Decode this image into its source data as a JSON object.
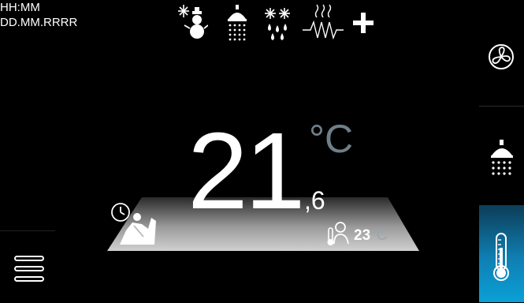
{
  "status": {
    "time": "HH:MM",
    "date": "DD.MM.RRRR"
  },
  "mode_icons": [
    "snowman-icon",
    "shower-icon",
    "snow-rain-icon",
    "heating-wave-icon",
    "plus-icon"
  ],
  "main": {
    "temp_integer": "21",
    "temp_decimal": ",6",
    "temp_unit": "°C",
    "room_temp_value": "23",
    "room_temp_unit": "°C"
  },
  "sidebar": {
    "items": [
      {
        "name": "ventilation",
        "icon": "fan-icon",
        "active": false
      },
      {
        "name": "hot-water",
        "icon": "shower-icon",
        "active": false
      },
      {
        "name": "heating",
        "icon": "thermometer-icon",
        "active": true
      }
    ]
  },
  "colors": {
    "background": "#000000",
    "active_tab": "#0aa0d6",
    "unit_gray": "#6e7f8a",
    "stage": "#bdbdbd"
  }
}
